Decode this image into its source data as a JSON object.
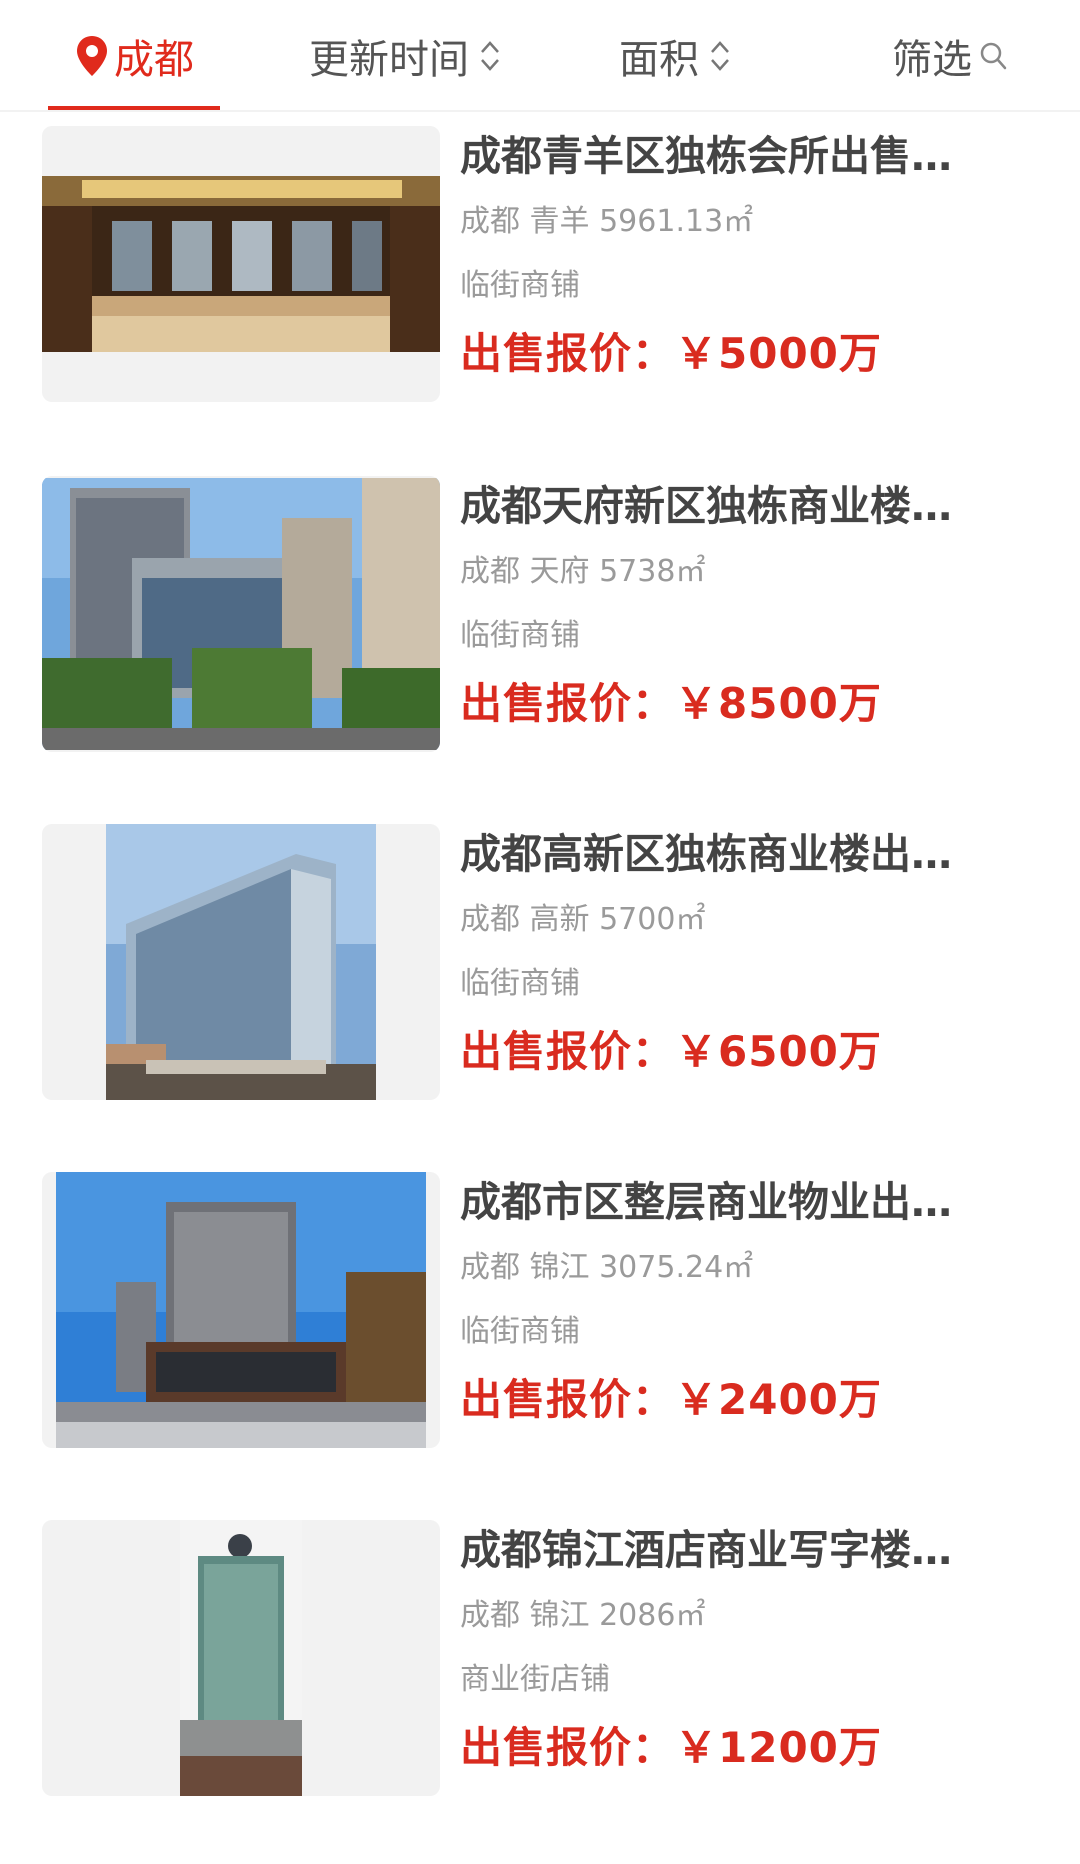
{
  "filter_bar": {
    "city": "成都",
    "sort_time": "更新时间",
    "sort_area": "面积",
    "screen": "筛选"
  },
  "listings": [
    {
      "title": "成都青羊区独栋会所出售…",
      "city": "成都",
      "district": "青羊",
      "area": "5961.13㎡",
      "type": "临街商铺",
      "price_label": "出售报价：",
      "price": "￥5000万"
    },
    {
      "title": "成都天府新区独栋商业楼…",
      "city": "成都",
      "district": "天府",
      "area": "5738㎡",
      "type": "临街商铺",
      "price_label": "出售报价：",
      "price": "￥8500万"
    },
    {
      "title": "成都高新区独栋商业楼出…",
      "city": "成都",
      "district": "高新",
      "area": "5700㎡",
      "type": "临街商铺",
      "price_label": "出售报价：",
      "price": "￥6500万"
    },
    {
      "title": "成都市区整层商业物业出…",
      "city": "成都",
      "district": "锦江",
      "area": "3075.24㎡",
      "type": "临街商铺",
      "price_label": "出售报价：",
      "price": "￥2400万"
    },
    {
      "title": "成都锦江酒店商业写字楼…",
      "city": "成都",
      "district": "锦江",
      "area": "2086㎡",
      "type": "商业街店铺",
      "price_label": "出售报价：",
      "price": "￥1200万"
    }
  ],
  "colors": {
    "accent": "#e02a1c",
    "price": "#d92b1f",
    "muted_text": "#9a9a9a",
    "title_text": "#444444"
  },
  "icons": {
    "city": "location-pin-icon",
    "sort": "sort-arrows-icon",
    "screen": "search-icon"
  }
}
